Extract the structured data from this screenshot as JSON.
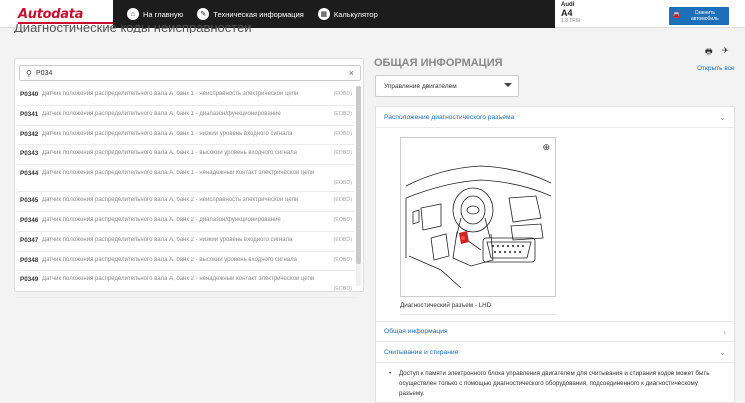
{
  "header": {
    "logo": "Autodata",
    "nav": [
      {
        "label": "На главную",
        "icon": "home-icon"
      },
      {
        "label": "Техническая информация",
        "icon": "wrench-icon"
      },
      {
        "label": "Калькулятор",
        "icon": "calculator-icon"
      }
    ],
    "vehicle": {
      "make": "Audi",
      "model": "A4",
      "engine": "1.8 TFSI"
    },
    "change_button": "Сменить автомобиль"
  },
  "page_title": "Диагностические коды неисправностей",
  "search": {
    "value": "P034",
    "placeholder": ""
  },
  "codes": [
    {
      "code": "P0340",
      "desc": "Датчик положения распределительного вала А, банк 1 - неисправность электрической цепи",
      "tag": "(EOBD)"
    },
    {
      "code": "P0341",
      "desc": "Датчик положения распределительного вала А, банк 1 - диапазон/функционирование",
      "tag": "(EOBD)"
    },
    {
      "code": "P0342",
      "desc": "Датчик положения распределительного вала А, банк 1 - низкий уровень входного сигнала",
      "tag": "(EOBD)"
    },
    {
      "code": "P0343",
      "desc": "Датчик положения распределительного вала А, банк 1 - высокий уровень входного сигнала",
      "tag": "(EOBD)"
    },
    {
      "code": "P0344",
      "desc": "Датчик положения распределительного вала А, банк 1 - ненадежный контакт электрической цепи",
      "tag": "(EOBD)"
    },
    {
      "code": "P0345",
      "desc": "Датчик положения распределительного вала А, банк 2 - неисправность электрической цепи",
      "tag": "(EOBD)"
    },
    {
      "code": "P0346",
      "desc": "Датчик положения распределительного вала А, банк 2 - диапазон/функционирование",
      "tag": "(EOBD)"
    },
    {
      "code": "P0347",
      "desc": "Датчик положения распределительного вала А, банк 2 - низкий уровень входного сигнала",
      "tag": "(EOBD)"
    },
    {
      "code": "P0348",
      "desc": "Датчик положения распределительного вала А, банк 2 - высокий уровень входного сигнала",
      "tag": "(EOBD)"
    },
    {
      "code": "P0349",
      "desc": "Датчик положения распределительного вала А, банк 2 - ненадежный контакт электрической цепи",
      "tag": "(EOBD)"
    }
  ],
  "general": {
    "title": "ОБЩАЯ ИНФОРМАЦИЯ",
    "open_all": "Открыть все",
    "system_select": "Управление двигателем",
    "sections": [
      {
        "label": "Расположение диагностического разъема"
      },
      {
        "label": "Общая информация"
      },
      {
        "label": "Считывание и стирание"
      }
    ],
    "image_caption": "Диагностический разъем - LHD",
    "bullet": "Доступ к памяти электронного блока управления двигателем для считывания и стирания кодов может быть осуществлен только с помощью диагностического оборудования, подсоединенного к диагностическому разъему."
  },
  "colors": {
    "brand_red": "#c8102e",
    "link_blue": "#1d6fb8",
    "nav_dark": "#1c1c1c"
  }
}
